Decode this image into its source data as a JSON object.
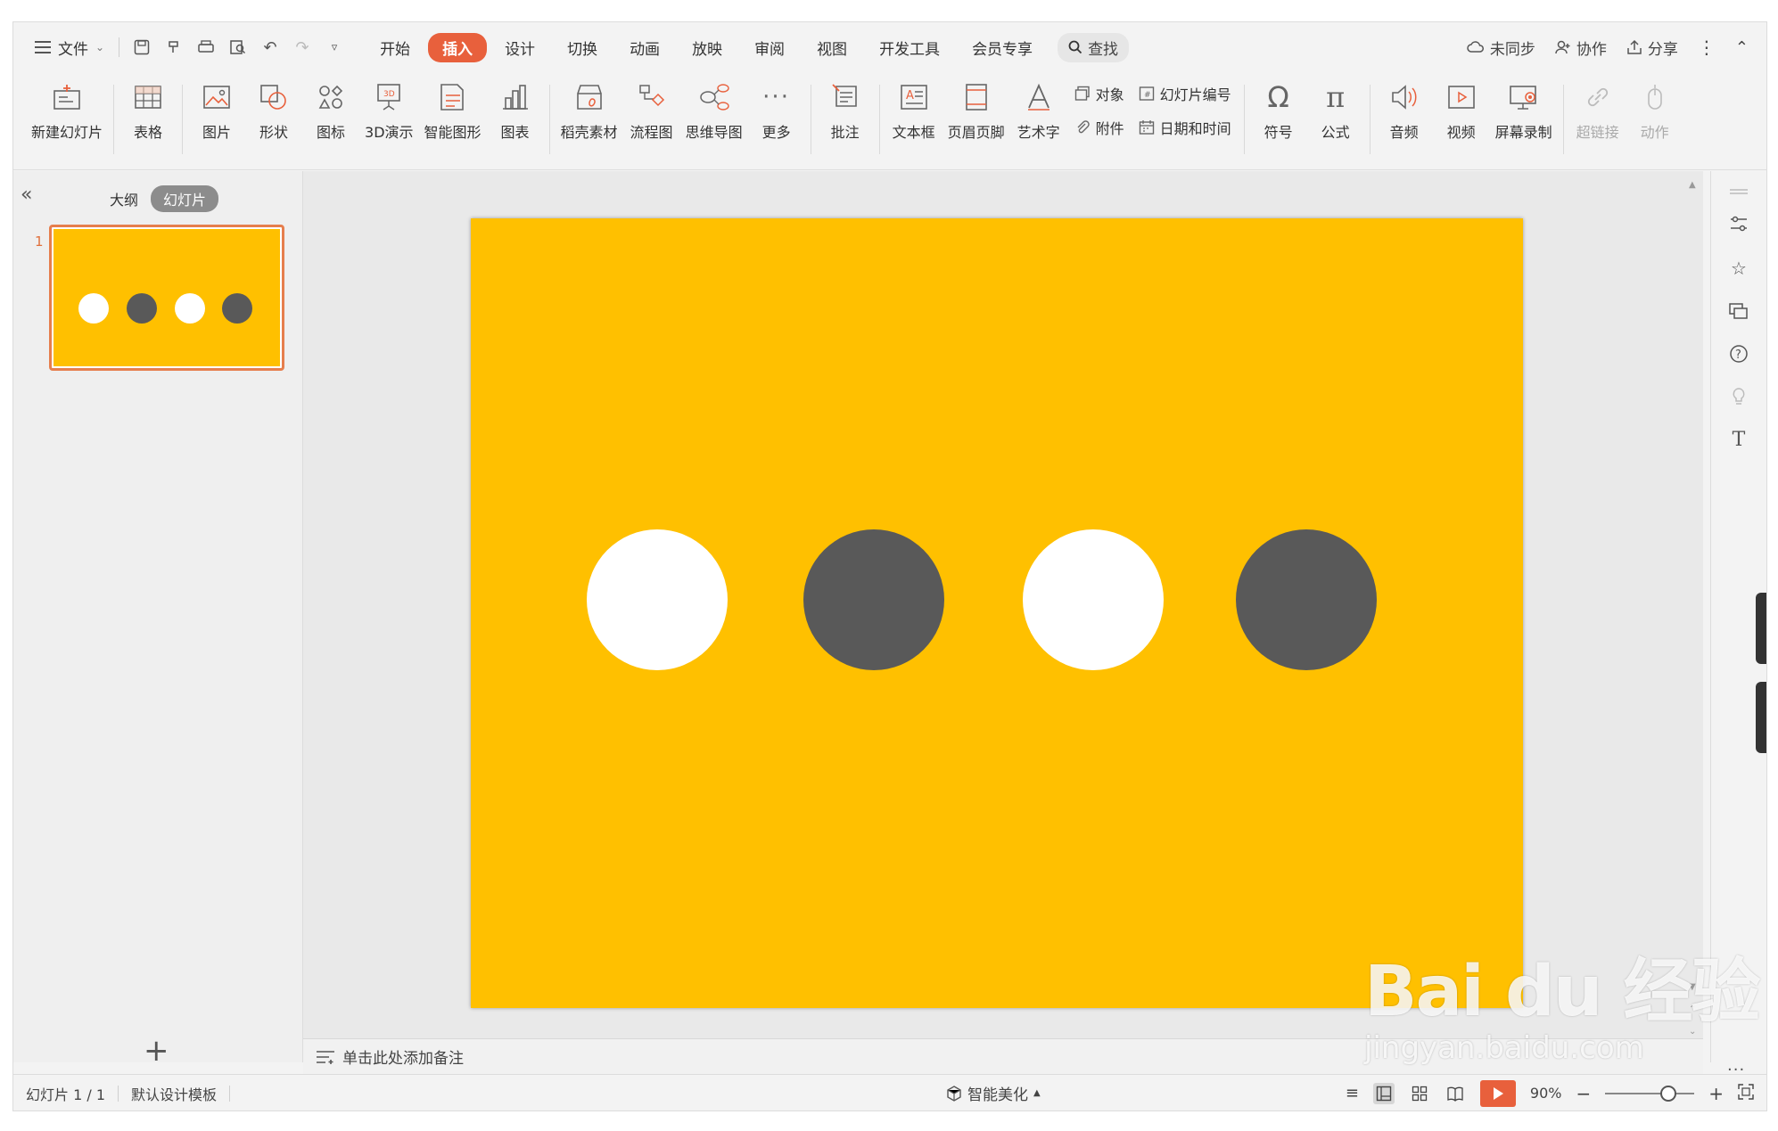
{
  "menu": {
    "file_label": "文件",
    "tabs": [
      {
        "label": "开始",
        "active": false
      },
      {
        "label": "插入",
        "active": true
      },
      {
        "label": "设计",
        "active": false
      },
      {
        "label": "切换",
        "active": false
      },
      {
        "label": "动画",
        "active": false
      },
      {
        "label": "放映",
        "active": false
      },
      {
        "label": "审阅",
        "active": false
      },
      {
        "label": "视图",
        "active": false
      },
      {
        "label": "开发工具",
        "active": false
      },
      {
        "label": "会员专享",
        "active": false
      }
    ],
    "search_label": "查找",
    "right": {
      "sync_label": "未同步",
      "collab_label": "协作",
      "share_label": "分享"
    }
  },
  "ribbon": {
    "new_slide": "新建幻灯片",
    "table": "表格",
    "picture": "图片",
    "shape": "形状",
    "icon": "图标",
    "demo3d": "3D演示",
    "smartart": "智能图形",
    "chart": "图表",
    "material": "稻壳素材",
    "flowchart": "流程图",
    "mindmap": "思维导图",
    "more": "更多",
    "comment": "批注",
    "textbox": "文本框",
    "header_footer": "页眉页脚",
    "wordart": "艺术字",
    "object": "对象",
    "slide_number": "幻灯片编号",
    "attachment": "附件",
    "datetime": "日期和时间",
    "symbol": "符号",
    "formula": "公式",
    "audio": "音频",
    "video": "视频",
    "screen_record": "屏幕录制",
    "hyperlink": "超链接",
    "action": "动作"
  },
  "left_panel": {
    "outline_tab": "大纲",
    "slides_tab": "幻灯片",
    "slide_number": "1",
    "add_label": "+"
  },
  "slide": {
    "background_color": "#ffc000",
    "circles": [
      {
        "color": "#ffffff"
      },
      {
        "color": "#595959"
      },
      {
        "color": "#ffffff"
      },
      {
        "color": "#595959"
      }
    ]
  },
  "notes": {
    "placeholder": "单击此处添加备注"
  },
  "status": {
    "slide_info": "幻灯片 1 / 1",
    "template": "默认设计模板",
    "beautify": "智能美化",
    "zoom": "90%"
  },
  "watermark": {
    "brand": "Bai du 经验",
    "url": "jingyan.baidu.com"
  }
}
